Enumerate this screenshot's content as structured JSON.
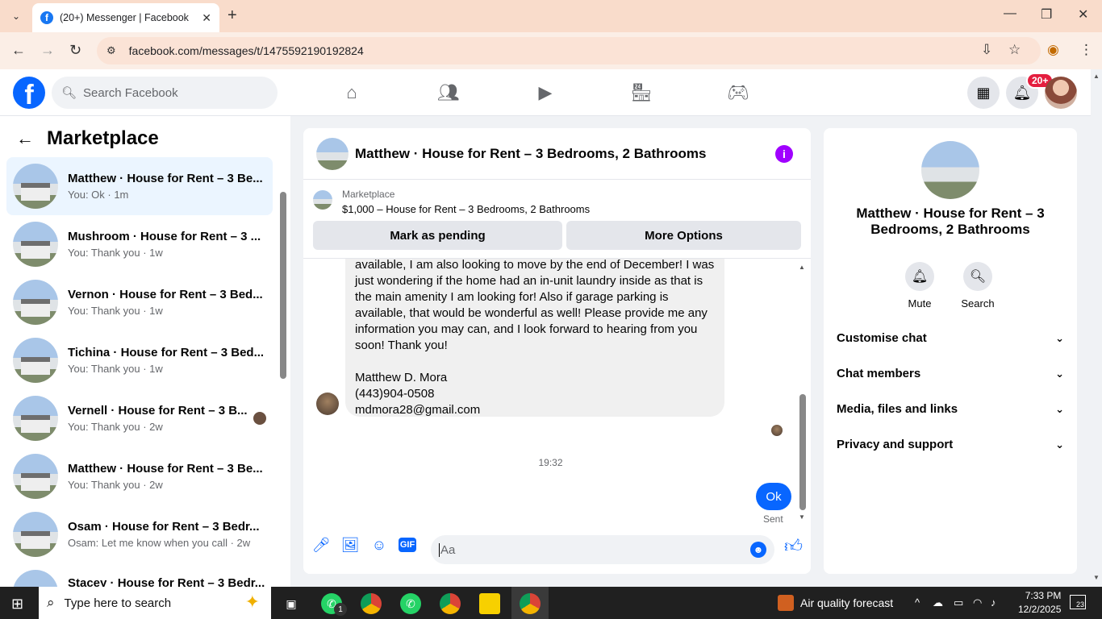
{
  "browser": {
    "tab_title": "(20+) Messenger | Facebook",
    "url": "facebook.com/messages/t/1475592190192824"
  },
  "fb_header": {
    "search_placeholder": "Search Facebook",
    "notification_badge": "20+"
  },
  "left_pane": {
    "title": "Marketplace",
    "conversations": [
      {
        "name": "Matthew · House for Rent – 3 Be...",
        "sub": "You: Ok · 1m",
        "active": true
      },
      {
        "name": "Mushroom · House for Rent – 3 ...",
        "sub": "You: Thank you · 1w"
      },
      {
        "name": "Vernon · House for Rent – 3 Bed...",
        "sub": "You: Thank you · 1w"
      },
      {
        "name": "Tichina · House for Rent – 3 Bed...",
        "sub": "You: Thank you · 1w"
      },
      {
        "name": "Vernell · House for Rent – 3 B...",
        "sub": "You: Thank you · 2w"
      },
      {
        "name": "Matthew · House for Rent – 3 Be...",
        "sub": "You: Thank you · 2w"
      },
      {
        "name": "Osam · House for Rent – 3 Bedr...",
        "sub": "Osam: Let me know when you call · 2w"
      },
      {
        "name": "Stacey · House for Rent – 3 Bedr...",
        "sub": ""
      }
    ]
  },
  "chat": {
    "title": "Matthew · House for Rent – 3 Bedrooms, 2 Bathrooms",
    "marketplace_label": "Marketplace",
    "listing": "$1,000 – House for Rent – 3 Bedrooms, 2 Bathrooms",
    "mark_pending": "Mark as pending",
    "more_options": "More Options",
    "message_text": "available, I am also looking to move by the end of December! I was just wondering if the home had an in-unit laundry inside as that is the main amenity I am looking for! Also if garage parking is available, that would be wonderful as well! Please provide me any information you may can, and I look forward to hearing from you soon! Thank you!\n\nMatthew D. Mora\n(443)904-0508\nmdmora28@gmail.com",
    "timestamp": "19:32",
    "my_message": "Ok",
    "status": "Sent",
    "input_placeholder": "Aa"
  },
  "right_pane": {
    "title": "Matthew · House for Rent – 3 Bedrooms, 2 Bathrooms",
    "mute": "Mute",
    "search": "Search",
    "sections": [
      "Customise chat",
      "Chat members",
      "Media, files and links",
      "Privacy and support"
    ]
  },
  "taskbar": {
    "search_placeholder": "Type here to search",
    "weather": "Air quality forecast",
    "time": "7:33 PM",
    "date": "12/2/2025",
    "notifications": "23",
    "whatsapp_badge": "1"
  }
}
